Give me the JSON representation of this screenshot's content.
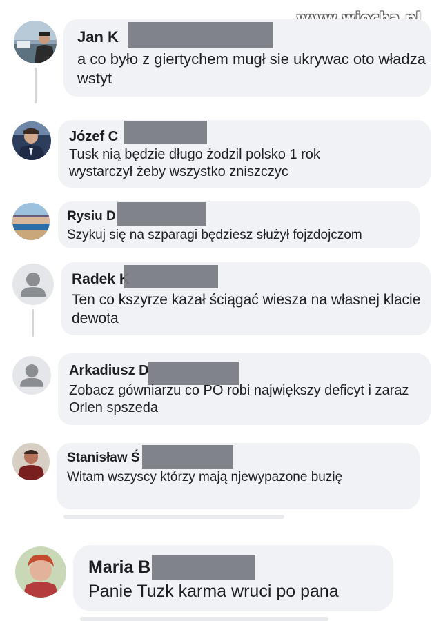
{
  "watermark": "www.wiocha.pl",
  "comments": [
    {
      "author": "Jan K",
      "text": "a co było z giertychem mugł sie ukrywac oto władza wstyt",
      "avatar_icon": "photo-avatar-man-cap-icon"
    },
    {
      "author": "Józef C",
      "text": "Tusk nią będzie długo żodzil polsko 1 rok wystarczył żeby wszystko zniszczyc",
      "avatar_icon": "photo-avatar-man-suit-icon"
    },
    {
      "author": "Rysiu D",
      "text": "Szykuj się na szparagi będziesz służył fojzdojczom",
      "avatar_icon": "photo-avatar-landscape-icon"
    },
    {
      "author": "Radek K",
      "text": "Ten co kszyrze kazał ściągać wiesza na własnej klacie dewota",
      "avatar_icon": "default-avatar-icon"
    },
    {
      "author": "Arkadiusz D",
      "text": "Zobacz gówniarzu  co PO robi największy deficyt i zaraz Orlen spszeda",
      "avatar_icon": "default-avatar-icon"
    },
    {
      "author": "Stanisław Ś",
      "text": "Witam  wszyscy  którzy  mają njewypazone buzię",
      "avatar_icon": "photo-avatar-man-icon"
    },
    {
      "author": "Maria B",
      "text": "Panie Tuzk karma wruci po pana",
      "avatar_icon": "photo-avatar-woman-icon"
    }
  ]
}
